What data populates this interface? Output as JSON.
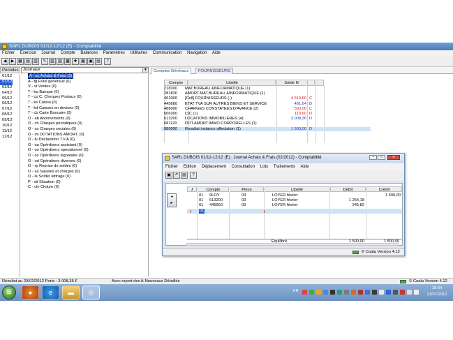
{
  "main_window": {
    "title": "SARL DUBOIS 01/12-12/12 (E) - Comptabilité",
    "menu": [
      "Fichier",
      "Exercice",
      "Journal",
      "Compte",
      "Balances",
      "Paramètres",
      "Utilitaires",
      "Communication",
      "Navigation",
      "Aide"
    ]
  },
  "periodes": {
    "header": "Périodes",
    "items": [
      "01/12",
      "02/12",
      "03/12",
      "04/12",
      "05/12",
      "06/12",
      "07/12",
      "08/12",
      "09/12",
      "10/12",
      "11/12",
      "12/12"
    ],
    "selected": "02/12"
  },
  "journaux": {
    "selected_label": "Journaux",
    "items": [
      "A - ac Achats & Frais (3)",
      "A - fg Frais generaux (0)",
      "V - vt Ventes (0)",
      "T - bq Banque (0)",
      "T - cp C. Cheques Postaux (0)",
      "T - ks Caisse (0)",
      "T - kd Caisses en devises (0)",
      "T - cb Carte Bancaire (0)",
      "O - ab Abonnements (0)",
      "O - ch Charges périodiques (0)",
      "O - so Charges sociales (0)",
      "O - im DOTATIONS AMORT. (0)",
      "O - tv Déclaration T.V.A (0)",
      "O - oa Opérdivers assistant (0)",
      "O - oo Opérdivers operationnel (0)",
      "O - os Opérdivers signataire (0)",
      "O - od Opérations diverses (0)",
      "O - rp Reprise de soldes (0)",
      "O - sa Salaires et charges (0)",
      "O - le Solder lettrage (0)",
      "P - sit Situation (0)",
      "C - clo Cloture (0)"
    ]
  },
  "tabs": [
    "Comptes Généraux",
    "FOURNISSEURS"
  ],
  "accounts": {
    "columns": [
      "Compte",
      "Libellé",
      "Solde N"
    ],
    "rows": [
      {
        "compte": "218300",
        "libelle": "MAT.BUREAU &INFORMATIQUE (1)",
        "solde": "",
        "sens": "",
        "color": "#000000"
      },
      {
        "compte": "281830",
        "libelle": "AMORT.MAT.BUREAU &INFORMATIQUE (1)",
        "solde": "",
        "sens": "",
        "color": "#000000"
      },
      {
        "compte": "401000",
        "libelle": "[Coll] FOURNISSEURS (-)",
        "solde": "4 619,60",
        "sens": "C",
        "color": "#d42020"
      },
      {
        "compte": "445660",
        "libelle": "ETAT TVA SUR AUTRES BIENS ET SERVICE",
        "solde": "491,64",
        "sens": "D",
        "color": "#1c3fae"
      },
      {
        "compte": "486000",
        "libelle": "CHARGES CONSTATEES D'AVANCE (2)",
        "solde": "500,00",
        "sens": "C",
        "color": "#d42020"
      },
      {
        "compte": "606300",
        "libelle": "CIC (1)",
        "solde": "119,60",
        "sens": "D",
        "color": "#d42020"
      },
      {
        "compte": "613200",
        "libelle": "LOCATIONS IMMOBILIERES (4)",
        "solde": "3 008,36",
        "sens": "D",
        "color": "#1c3fae"
      },
      {
        "compte": "681120",
        "libelle": "DOT.AMORT.IMMO.CORPORELLES (1)",
        "solde": "",
        "sens": "",
        "color": "#000000"
      },
      {
        "compte": "880000",
        "libelle": "Resultat instance affectation (1)",
        "solde": "1 500,00",
        "sens": "D",
        "color": "#1c3fae"
      }
    ]
  },
  "dialog": {
    "title": "SARL DUBOIS 01/12-12/12 (E) : Journal Achats & Frais (02/2012)  - Comptabilité",
    "menu": [
      "Fichier",
      "Edition",
      "Déplacement",
      "Consultation",
      "Lots",
      "Traitements",
      "Aide"
    ],
    "columns": [
      "J",
      "Compte",
      "Pièce",
      "Libellé",
      "Débit",
      "Crédit"
    ],
    "rows": [
      {
        "j": "01",
        "compte": "9LOY",
        "piece": "03",
        "libelle": "LOYER février",
        "debit": "",
        "credit": "1 500,00"
      },
      {
        "j": "01",
        "compte": "613200",
        "piece": "03",
        "libelle": "LOYER février",
        "debit": "1 254,18",
        "credit": ""
      },
      {
        "j": "01",
        "compte": "445660",
        "piece": "03",
        "libelle": "LOYER février",
        "debit": "245,82",
        "credit": ""
      }
    ],
    "new_row_j": "01",
    "total_label": "Equilibré",
    "total_debit": "1 500,00",
    "total_credit": "1 500,00",
    "version": "© Coala Version 4.12"
  },
  "status_bar": {
    "left": "Résultat au 29/02/2012 Perte : 3 008,36 €",
    "middle": "Avec report des A-Nouveaux Détaillés",
    "right": "© Coala Version 4.12"
  },
  "taskbar": {
    "language": "FR",
    "time": "15:34",
    "date": "21/07/2012"
  }
}
